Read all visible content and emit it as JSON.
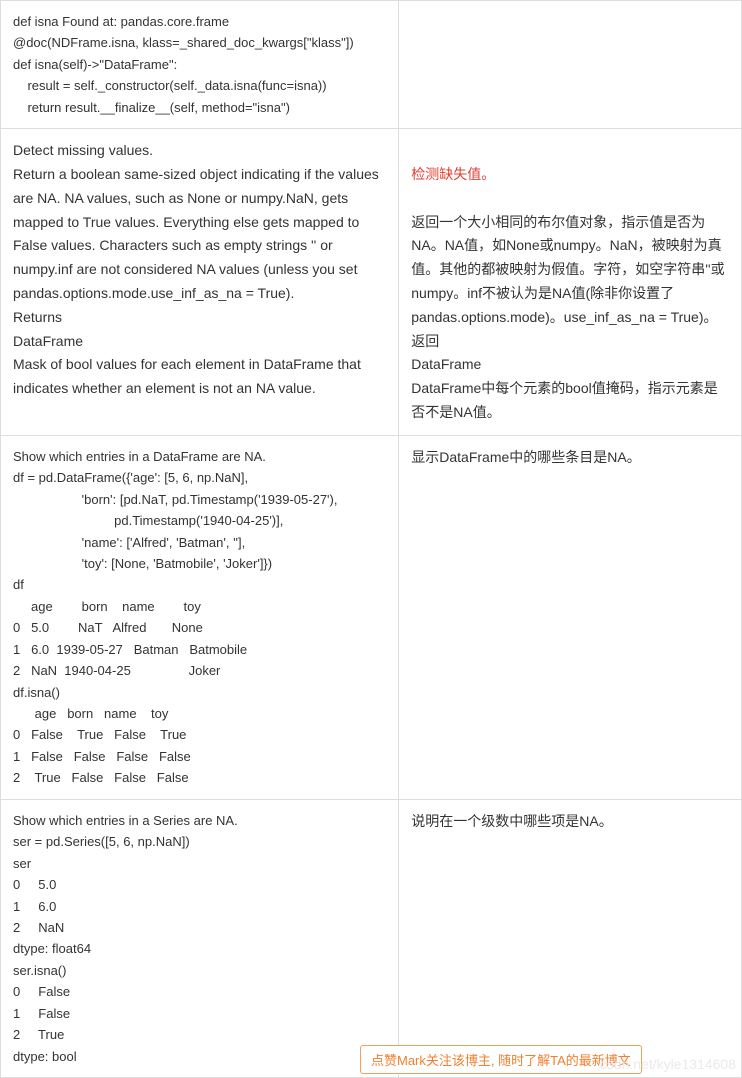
{
  "row1": {
    "left": "def isna Found at: pandas.core.frame\n@doc(NDFrame.isna, klass=_shared_doc_kwargs[\"klass\"])\ndef isna(self)->\"DataFrame\":\n    result = self._constructor(self._data.isna(func=isna))\n    return result.__finalize__(self, method=\"isna\")",
    "right": ""
  },
  "row2": {
    "left": "Detect missing values.\nReturn a boolean same-sized object indicating if the values are NA. NA values, such as None or numpy.NaN, gets mapped to True values. Everything else gets mapped to False values. Characters such as empty strings '' or numpy.inf are not considered NA values (unless you set pandas.options.mode.use_inf_as_na = True).\nReturns\nDataFrame\nMask of bool values for each element in DataFrame that indicates whether an element is not an NA value.",
    "right_red": "检测缺失值。",
    "right_rest": "返回一个大小相同的布尔值对象，指示值是否为NA。NA值，如None或numpy。NaN，被映射为真值。其他的都被映射为假值。字符，如空字符串''或numpy。inf不被认为是NA值(除非你设置了pandas.options.mode)。use_inf_as_na = True)。\n返回\nDataFrame\nDataFrame中每个元素的bool值掩码，指示元素是否不是NA值。"
  },
  "row3": {
    "left": "Show which entries in a DataFrame are NA.\ndf = pd.DataFrame({'age': [5, 6, np.NaN],\n                   'born': [pd.NaT, pd.Timestamp('1939-05-27'),\n                            pd.Timestamp('1940-04-25')],\n                   'name': ['Alfred', 'Batman', ''],\n                   'toy': [None, 'Batmobile', 'Joker']})\ndf\n     age        born    name        toy\n0   5.0        NaT   Alfred       None\n1   6.0  1939-05-27   Batman   Batmobile\n2   NaN  1940-04-25                Joker\ndf.isna()\n      age   born   name    toy\n0   False    True   False    True\n1   False   False   False   False\n2    True   False   False   False",
    "right": "显示DataFrame中的哪些条目是NA。"
  },
  "row4": {
    "left": "Show which entries in a Series are NA.\nser = pd.Series([5, 6, np.NaN])\nser\n0     5.0\n1     6.0\n2     NaN\ndtype: float64\nser.isna()\n0     False\n1     False\n2     True\ndtype: bool",
    "right": "说明在一个级数中哪些项是NA。"
  },
  "popup": "点赞Mark关注该博主, 随时了解TA的最新博文",
  "watermark": "csdn.net/kyle1314608"
}
